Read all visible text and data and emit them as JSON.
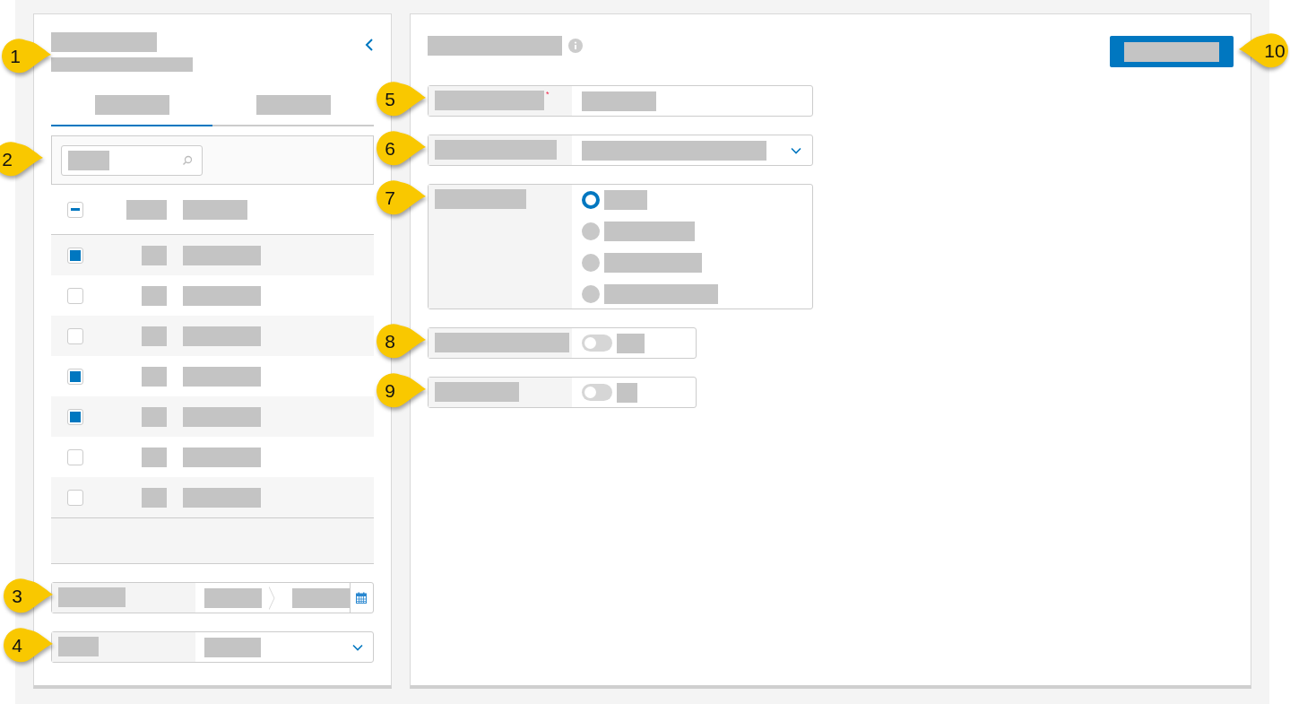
{
  "sidebar": {
    "callout": "1",
    "tabs": [
      {
        "selected": true
      },
      {
        "selected": false
      }
    ],
    "search": {
      "callout": "2"
    },
    "table": {
      "select_all_indeterminate": true,
      "rows": [
        {
          "checked": true
        },
        {
          "checked": false
        },
        {
          "checked": false
        },
        {
          "checked": true
        },
        {
          "checked": true
        },
        {
          "checked": false
        },
        {
          "checked": false
        }
      ]
    },
    "date_range": {
      "callout": "3"
    },
    "dropdown": {
      "callout": "4"
    }
  },
  "form": {
    "fields": [
      {
        "kind": "text",
        "callout": "5",
        "required_mark": "*"
      },
      {
        "kind": "select",
        "callout": "6"
      },
      {
        "kind": "radio",
        "callout": "7",
        "options": [
          {
            "selected": true
          },
          {
            "selected": false
          },
          {
            "selected": false
          },
          {
            "selected": false
          }
        ]
      },
      {
        "kind": "toggle",
        "callout": "8",
        "on": false
      },
      {
        "kind": "toggle",
        "callout": "9",
        "on": false
      }
    ],
    "button": {
      "callout": "10"
    }
  }
}
